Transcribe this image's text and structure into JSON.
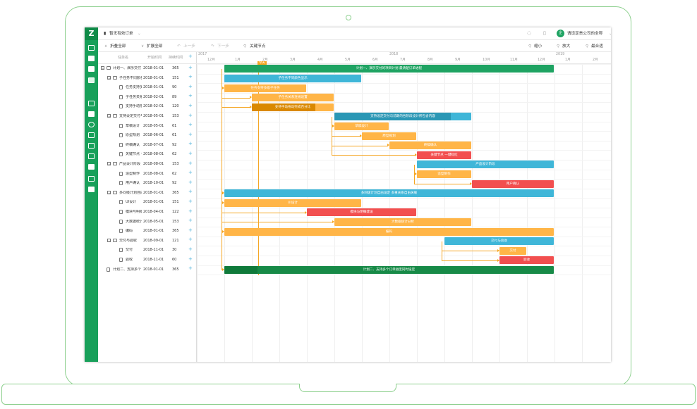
{
  "header": {
    "project": "暂无有效订单",
    "user": "请设定贵公司的全称",
    "avatar": "企"
  },
  "toolbar": {
    "collapse": "折叠全部",
    "expand": "扩展全部",
    "undo": "上一步",
    "redo": "下一步",
    "critical": "关键节点",
    "zoom_out": "缩小",
    "zoom_in": "放大",
    "fit": "最合适"
  },
  "columns": {
    "name": "任务名",
    "start": "开始时间",
    "duration": "持续时间"
  },
  "tasks": [
    {
      "name": "计划一、演示交付",
      "start": "2018-01-01",
      "dur": "365",
      "lvl": 0,
      "toggle": "−",
      "folder": true
    },
    {
      "name": "子任务不同颜色",
      "start": "2018-01-01",
      "dur": "151",
      "lvl": 1,
      "toggle": "−",
      "folder": true
    },
    {
      "name": "任务支持多级",
      "start": "2018-01-01",
      "dur": "90",
      "lvl": 2
    },
    {
      "name": "子任务关系连",
      "start": "2018-02-01",
      "dur": "89",
      "lvl": 2
    },
    {
      "name": "支持手动拖动",
      "start": "2018-02-01",
      "dur": "120",
      "lvl": 2
    },
    {
      "name": "支持设定交付与",
      "start": "2018-05-01",
      "dur": "153",
      "lvl": 1,
      "toggle": "−",
      "folder": true
    },
    {
      "name": "草稿设计",
      "start": "2018-05-01",
      "dur": "61",
      "lvl": 2
    },
    {
      "name": "原型规划",
      "start": "2018-06-01",
      "dur": "61",
      "lvl": 2
    },
    {
      "name": "终稿确认",
      "start": "2018-07-01",
      "dur": "92",
      "lvl": 2
    },
    {
      "name": "关键节点 一键",
      "start": "2018-08-01",
      "dur": "62",
      "lvl": 2
    },
    {
      "name": "产品设计阶段",
      "start": "2018-08-01",
      "dur": "153",
      "lvl": 1,
      "toggle": "−",
      "folder": true
    },
    {
      "name": "造型制作",
      "start": "2018-08-01",
      "dur": "62",
      "lvl": 2
    },
    {
      "name": "用户确认",
      "start": "2018-10-01",
      "dur": "92",
      "lvl": 2
    },
    {
      "name": "多同级计划自由",
      "start": "2018-01-01",
      "dur": "365",
      "lvl": 1,
      "toggle": "−",
      "folder": true
    },
    {
      "name": "UI设计",
      "start": "2018-01-01",
      "dur": "151",
      "lvl": 2
    },
    {
      "name": "模块与明细建",
      "start": "2018-04-01",
      "dur": "122",
      "lvl": 2
    },
    {
      "name": "大数据统计分",
      "start": "2018-05-01",
      "dur": "153",
      "lvl": 2
    },
    {
      "name": "编码",
      "start": "2018-01-01",
      "dur": "365",
      "lvl": 2
    },
    {
      "name": "交付与验收",
      "start": "2018-09-01",
      "dur": "121",
      "lvl": 1,
      "toggle": "−",
      "folder": true
    },
    {
      "name": "交付",
      "start": "2018-11-01",
      "dur": "30",
      "lvl": 2
    },
    {
      "name": "验收",
      "start": "2018-11-01",
      "dur": "60",
      "lvl": 2
    },
    {
      "name": "计划二、支持多个",
      "start": "2018-01-01",
      "dur": "365",
      "lvl": 0
    }
  ],
  "timeline": {
    "years": [
      "2017",
      "2018",
      "2019"
    ],
    "months": [
      "12月",
      "1月",
      "2月",
      "3月",
      "4月",
      "5月",
      "6月",
      "7月",
      "8月",
      "9月",
      "10月",
      "11月",
      "12月",
      "1月",
      "2月"
    ],
    "today": "今天"
  },
  "chart_data": {
    "type": "gantt",
    "x_unit": "month",
    "bars": [
      {
        "row": 0,
        "start": "2018-01",
        "months": 12,
        "label": "计划一、演示交付的项目计划 最清楚订单进程",
        "color": "#1ea362"
      },
      {
        "row": 1,
        "start": "2018-01",
        "months": 5,
        "label": "子任务不同颜色显示",
        "color": "#3fb6d8"
      },
      {
        "row": 2,
        "start": "2018-01",
        "months": 3,
        "label": "任务支持多级子任务",
        "color": "#ffb547"
      },
      {
        "row": 3,
        "start": "2018-02",
        "months": 3,
        "label": "子任务关系连线设置",
        "color": "#ffb547"
      },
      {
        "row": 4,
        "start": "2018-02",
        "months": 3,
        "label": "支持手动拖动完成百分比",
        "color": "#ffb547",
        "progress": 0.78,
        "progress_color": "#d98800"
      },
      {
        "row": 5,
        "start": "2018-05",
        "months": 5,
        "label": "支持设定交付与前期的各阶段设计所包含内容",
        "color": "#3fb6d8",
        "progress": 0.85,
        "progress_color": "#2a97b5"
      },
      {
        "row": 6,
        "start": "2018-05",
        "months": 2,
        "label": "草稿设计",
        "color": "#ffb547"
      },
      {
        "row": 7,
        "start": "2018-06",
        "months": 2,
        "label": "原型规划",
        "color": "#ffb547"
      },
      {
        "row": 8,
        "start": "2018-07",
        "months": 3,
        "label": "终稿确认",
        "color": "#ffb547"
      },
      {
        "row": 9,
        "start": "2018-08",
        "months": 2,
        "label": "关键节点 一键标红",
        "color": "#f24f4f"
      },
      {
        "row": 10,
        "start": "2018-08",
        "months": 5,
        "label": "产品设计阶段",
        "color": "#3fb6d8"
      },
      {
        "row": 11,
        "start": "2018-08",
        "months": 2,
        "label": "造型制作",
        "color": "#ffb547"
      },
      {
        "row": 12,
        "start": "2018-10",
        "months": 3,
        "label": "用户确认",
        "color": "#f24f4f"
      },
      {
        "row": 13,
        "start": "2018-01",
        "months": 12,
        "label": "多同级计划自由设定 多重关系自由关联",
        "color": "#3fb6d8"
      },
      {
        "row": 14,
        "start": "2018-01",
        "months": 5,
        "label": "UI设计",
        "color": "#ffb547"
      },
      {
        "row": 15,
        "start": "2018-04",
        "months": 4,
        "label": "模块与明细建设",
        "color": "#f24f4f"
      },
      {
        "row": 16,
        "start": "2018-05",
        "months": 5,
        "label": "大数据统计分析",
        "color": "#ffb547"
      },
      {
        "row": 17,
        "start": "2018-01",
        "months": 12,
        "label": "编码",
        "color": "#ffb547"
      },
      {
        "row": 18,
        "start": "2018-09",
        "months": 4,
        "label": "交付与验收",
        "color": "#3fb6d8"
      },
      {
        "row": 19,
        "start": "2018-11",
        "months": 1,
        "label": "交付",
        "color": "#ffb547"
      },
      {
        "row": 20,
        "start": "2018-11",
        "months": 2,
        "label": "验收",
        "color": "#f24f4f"
      },
      {
        "row": 21,
        "start": "2018-01",
        "months": 12,
        "label": "计划二、支持多个订单进度同时设定",
        "color": "#178a47",
        "progress": 0.1,
        "progress_color": "#0f7a3a"
      }
    ],
    "today_month": "2018-02"
  }
}
